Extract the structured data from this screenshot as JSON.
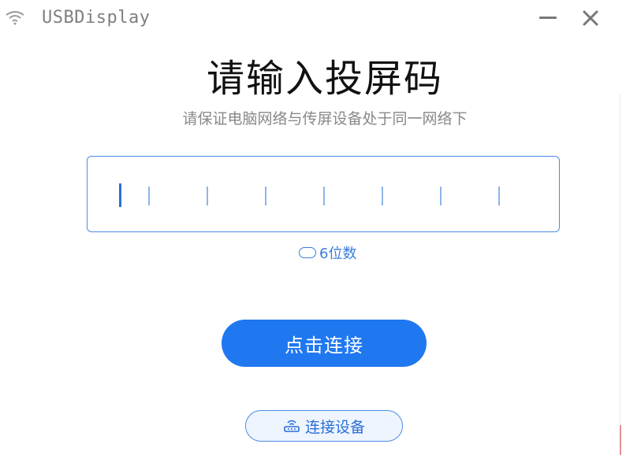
{
  "titlebar": {
    "app_title": "USBDisplay",
    "minimize_icon": "minimize-icon",
    "close_icon": "close-icon"
  },
  "main": {
    "heading": "请输入投屏码",
    "subtitle": "请保证电脑网络与传屏设备处于同一网络下",
    "code_input": {
      "value": "",
      "slot_count": 7
    },
    "digits_hint": "6位数",
    "connect_button": "点击连接",
    "device_button": "连接设备"
  },
  "colors": {
    "accent": "#1f78f0",
    "border": "#4a8be6",
    "hint_text": "#3a7de0"
  }
}
